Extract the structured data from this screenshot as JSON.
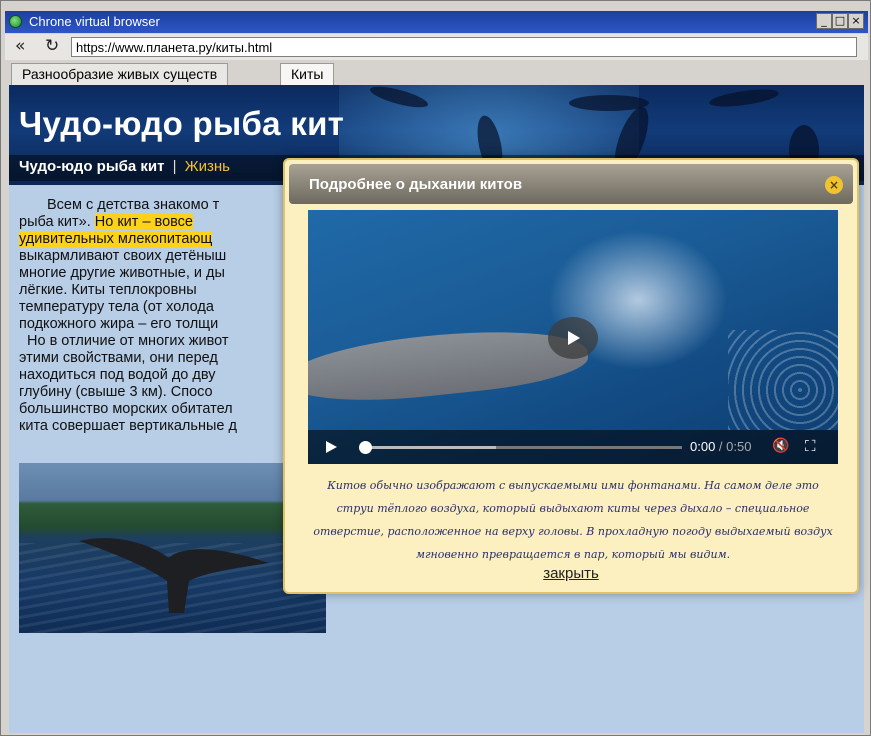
{
  "window": {
    "title": "Chrone virtual browser",
    "buttons": {
      "minimize": "_",
      "maximize": "□",
      "close": "×"
    }
  },
  "address_bar": {
    "back_glyph": "«",
    "reload_glyph": "↻",
    "url": "https://www.планета.ру/киты.html"
  },
  "tabs": [
    {
      "label": "Разнообразие живых существ"
    },
    {
      "label": "Киты"
    }
  ],
  "page": {
    "title": "Чудо-юдо рыба кит",
    "nav": {
      "current": "Чудо-юдо рыба кит",
      "separator": "|",
      "link": "Жизнь"
    },
    "article": {
      "part1": "Всем с детства знакомо т",
      "part2": "рыба кит».",
      "highlight1": "Но кит – вовсе",
      "highlight2": "удивительных млекопитающ",
      "lines": [
        "выкармливают своих детёныш",
        "многие другие животные, и ды",
        "лёгкие. Киты теплокровны",
        "температуру тела (от холода",
        "подкожного жира – его толщи",
        "Но в отличие от многих живот",
        "этими свойствами, они перед",
        "находиться под водой до дву",
        "глубину (свыше 3 км). Спосо",
        "большинство морских обитател",
        "кита совершает вертикальные д"
      ]
    }
  },
  "overlay": {
    "title": "Подробнее о дыхании китов",
    "close_glyph": "×",
    "video": {
      "current_time": "0:00",
      "separator": " / ",
      "duration": "0:50",
      "played_fraction": 0.0,
      "buffered_fraction": 0.42
    },
    "text": "Китов обычно изображают с выпускаемыми ими фонтанами. На самом деле это струи тёплого воздуха, который выдыхают киты через дыхало – специальное отверстие, расположенное на верху головы. В прохладную погоду выдыхаемый воздух мгновенно превращается в пар, который мы видим.",
    "close_link": "закрыть"
  }
}
